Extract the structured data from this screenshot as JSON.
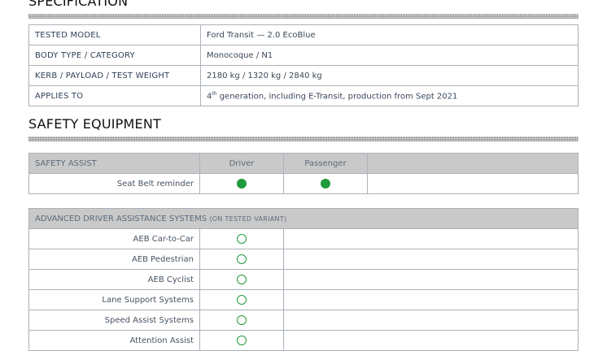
{
  "specification": {
    "title": "SPECIFICATION",
    "rows": [
      {
        "label": "TESTED MODEL",
        "value": "Ford Transit — 2.0 EcoBlue"
      },
      {
        "label": "BODY TYPE / CATEGORY",
        "value": "Monocoque / N1"
      },
      {
        "label": "KERB / PAYLOAD / TEST WEIGHT",
        "value": "2180 kg / 1320 kg / 2840 kg"
      }
    ],
    "applies_to": {
      "label": "APPLIES TO",
      "value_num": "4",
      "value_sup": "th",
      "value_rest": " generation, including E-Transit, production from Sept 2021"
    }
  },
  "safety_equipment": {
    "title": "SAFETY EQUIPMENT",
    "safety_assist": {
      "header": "SAFETY ASSIST",
      "col_driver": "Driver",
      "col_passenger": "Passenger",
      "rows": [
        {
          "label": "Seat Belt reminder",
          "driver": "fitted",
          "passenger": "fitted"
        }
      ]
    },
    "adas": {
      "header": "ADVANCED DRIVER ASSISTANCE SYSTEMS",
      "header_note": "(on tested variant)",
      "rows": [
        {
          "label": "AEB Car-to-Car",
          "status": "available"
        },
        {
          "label": "AEB Pedestrian",
          "status": "available"
        },
        {
          "label": "AEB Cyclist",
          "status": "available"
        },
        {
          "label": "Lane Support Systems",
          "status": "available"
        },
        {
          "label": "Speed Assist Systems",
          "status": "available"
        },
        {
          "label": "Attention Assist",
          "status": "available"
        }
      ]
    }
  },
  "colors": {
    "fitted": "#1f9a3c",
    "header_bg": "#c9c9c9",
    "border": "#aab2bb"
  }
}
